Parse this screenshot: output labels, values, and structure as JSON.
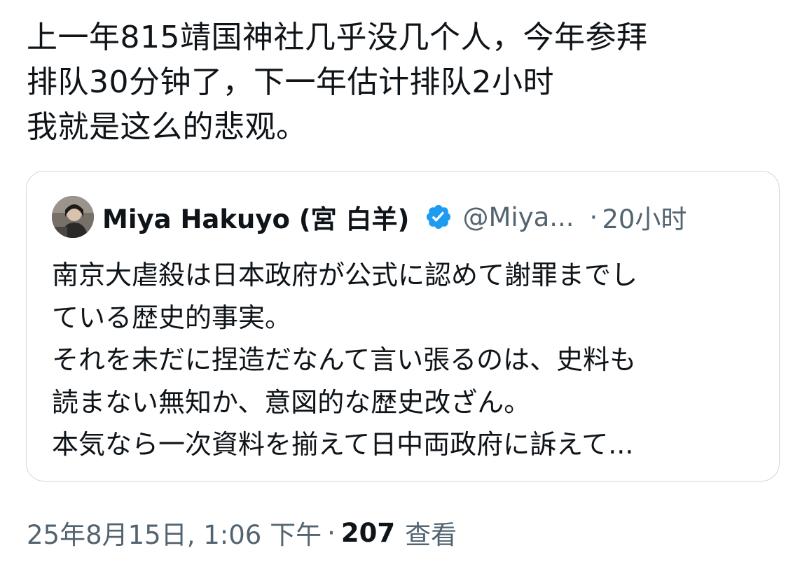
{
  "tweet": {
    "lines": [
      "上一年815靖国神社几乎没几个人，今年参拜",
      "排队30分钟了，下一年估计排队2小时",
      "我就是这么的悲观。"
    ]
  },
  "quote": {
    "display_name": "Miya Hakuyo (宮 白羊)",
    "handle": "@Miya...",
    "separator": "·",
    "time": "20小时",
    "verified_icon": "verified-badge-icon",
    "verified_color": "#1d9bf0",
    "lines": [
      "南京大虐殺は日本政府が公式に認めて謝罪までし",
      "ている歴史的事実。",
      "それを未だに捏造だなんて言い張るのは、史料も",
      "読まない無知か、意図的な歴史改ざん。",
      "本気なら一次資料を揃えて日中両政府に訴えて..."
    ]
  },
  "meta": {
    "datetime": "25年8月15日, 1:06 下午",
    "separator": "·",
    "views_count": "207",
    "views_label": "查看"
  }
}
